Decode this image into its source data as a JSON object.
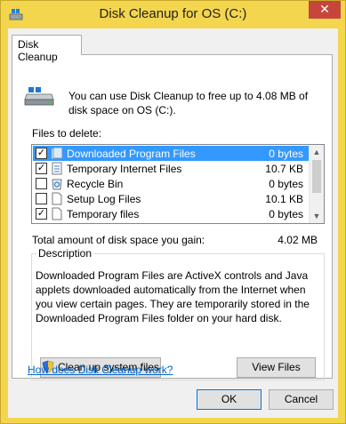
{
  "window": {
    "title": "Disk Cleanup for OS (C:)",
    "close_glyph": "✕"
  },
  "tab": {
    "label": "Disk Cleanup"
  },
  "intro_text": "You can use Disk Cleanup to free up to 4.08 MB of disk space on OS (C:).",
  "files_label": "Files to delete:",
  "files": [
    {
      "name": "Downloaded Program Files",
      "size": "0 bytes",
      "checked": true,
      "selected": true,
      "icon": "folder-icon"
    },
    {
      "name": "Temporary Internet Files",
      "size": "10.7 KB",
      "checked": true,
      "selected": false,
      "icon": "internet-files-icon"
    },
    {
      "name": "Recycle Bin",
      "size": "0 bytes",
      "checked": false,
      "selected": false,
      "icon": "recycle-bin-icon"
    },
    {
      "name": "Setup Log Files",
      "size": "10.1 KB",
      "checked": false,
      "selected": false,
      "icon": "document-icon"
    },
    {
      "name": "Temporary files",
      "size": "0 bytes",
      "checked": true,
      "selected": false,
      "icon": "document-icon"
    }
  ],
  "total": {
    "label": "Total amount of disk space you gain:",
    "value": "4.02 MB"
  },
  "description": {
    "legend": "Description",
    "text": "Downloaded Program Files are ActiveX controls and Java applets downloaded automatically from the Internet when you view certain pages. They are temporarily stored in the Downloaded Program Files folder on your hard disk."
  },
  "buttons": {
    "cleanup_system": "Clean up system files",
    "view_files": "View Files",
    "ok": "OK",
    "cancel": "Cancel"
  },
  "help_link": "How does Disk Cleanup work?",
  "colors": {
    "title_bar": "#f3d64e",
    "selection": "#3399ff",
    "close_button": "#c7463c",
    "link": "#0066cc"
  }
}
